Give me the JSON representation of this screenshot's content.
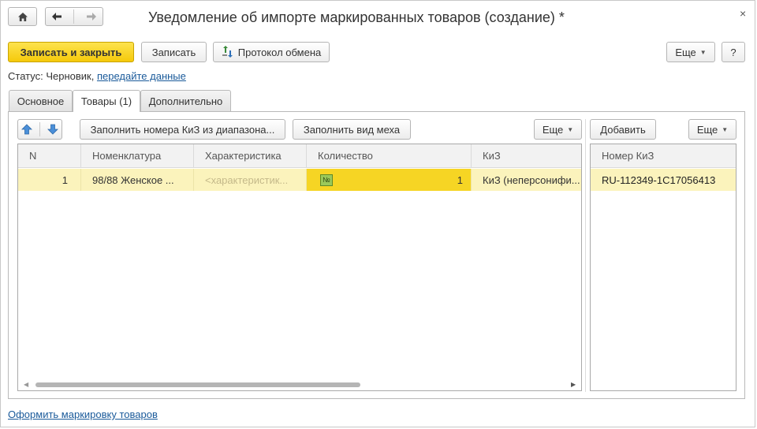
{
  "window": {
    "title": "Уведомление об импорте маркированных товаров (создание) *",
    "close_glyph": "×",
    "nav": {
      "home_icon": "home-icon",
      "back_icon": "arrow-left-icon",
      "forward_icon": "arrow-right-icon"
    }
  },
  "toolbar": {
    "save_close_label": "Записать и закрыть",
    "save_label": "Записать",
    "protocol_label": "Протокол обмена",
    "more_label": "Еще",
    "help_label": "?"
  },
  "status": {
    "prefix": "Статус: Черновик,",
    "link": "передайте данные"
  },
  "tabs": [
    {
      "label": "Основное",
      "active": false
    },
    {
      "label": "Товары (1)",
      "active": true
    },
    {
      "label": "Дополнительно",
      "active": false
    }
  ],
  "goods": {
    "toolbar": {
      "fill_kiz_label": "Заполнить номера КиЗ из диапазона...",
      "fill_fur_label": "Заполнить вид меха",
      "more_label": "Еще"
    },
    "columns": [
      "N",
      "Номенклатура",
      "Характеристика",
      "Количество",
      "КиЗ"
    ],
    "rows": [
      {
        "n": "1",
        "nomenclature": "98/88 Женское ...",
        "characteristic": "<характеристик...",
        "quantity": "1",
        "kiz": "КиЗ (неперсонифи..."
      }
    ],
    "quantity_badge": "№"
  },
  "kiz_panel": {
    "add_label": "Добавить",
    "more_label": "Еще",
    "column": "Номер КиЗ",
    "rows": [
      "RU-112349-1C17056413"
    ]
  },
  "footer": {
    "link": "Оформить маркировку товаров"
  },
  "colors": {
    "accent_yellow": "#f5c90a",
    "link": "#1a5a9a",
    "row_highlight": "#fbf3bc",
    "selected_cell": "#f6d524"
  }
}
